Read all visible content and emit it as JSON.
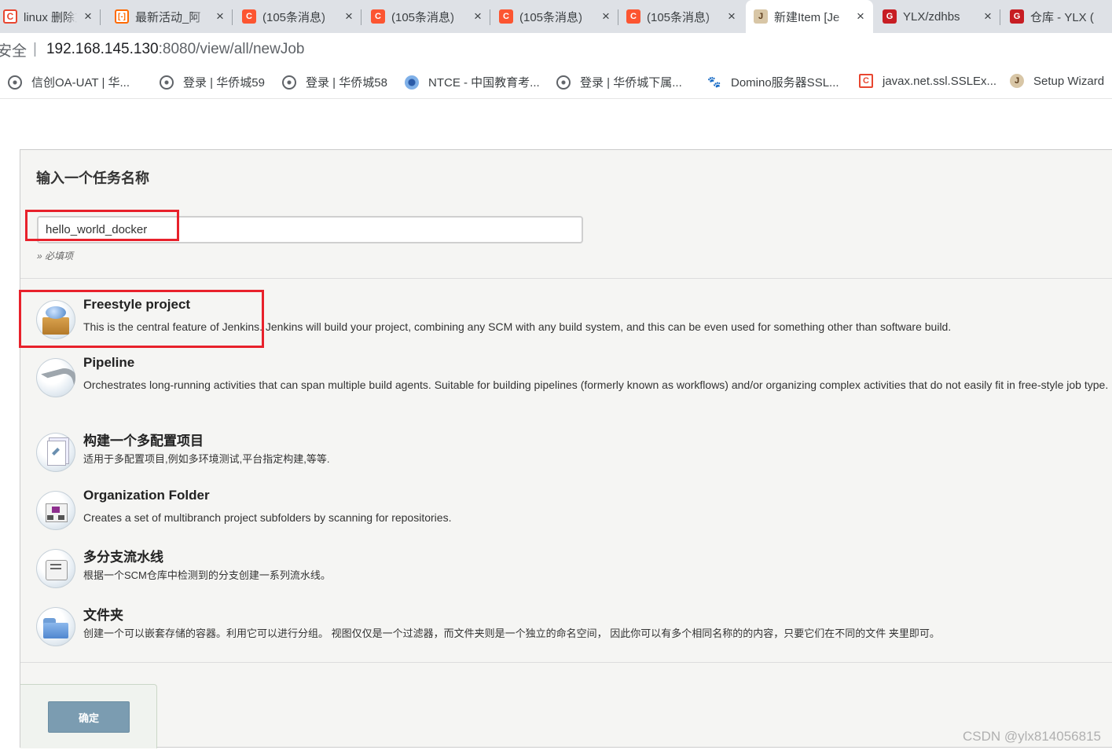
{
  "browser": {
    "tabs": [
      {
        "title": "linux 删除文",
        "favicon": "csdn-b",
        "glyph": "C"
      },
      {
        "title": "最新活动_阿",
        "favicon": "ali",
        "glyph": "[-]"
      },
      {
        "title": "(105条消息)",
        "favicon": "csdn",
        "glyph": "C"
      },
      {
        "title": "(105条消息)",
        "favicon": "csdn",
        "glyph": "C"
      },
      {
        "title": "(105条消息)",
        "favicon": "csdn",
        "glyph": "C"
      },
      {
        "title": "(105条消息)",
        "favicon": "csdn",
        "glyph": "C"
      },
      {
        "title": "新建Item [Je",
        "favicon": "jenkins",
        "glyph": "J"
      },
      {
        "title": "YLX/zdhbs",
        "favicon": "gitee",
        "glyph": "G"
      },
      {
        "title": "仓库 - YLX (",
        "favicon": "gitee",
        "glyph": "G"
      }
    ],
    "close_glyph": "×",
    "address": {
      "security": "安全",
      "separator": "|",
      "host": "192.168.145.130",
      "path": ":8080/view/all/newJob"
    },
    "bookmarks": [
      {
        "label": "信创OA-UAT | 华...",
        "icon": "globe-icon"
      },
      {
        "label": "登录 | 华侨城59",
        "icon": "globe-icon"
      },
      {
        "label": "登录 | 华侨城58",
        "icon": "globe-icon"
      },
      {
        "label": "NTCE - 中国教育考...",
        "icon": "ntce-icon"
      },
      {
        "label": "登录 | 华侨城下属...",
        "icon": "globe-icon"
      },
      {
        "label": "Domino服务器SSL...",
        "icon": "baidu-icon"
      },
      {
        "label": "javax.net.ssl.SSLEx...",
        "icon": "csdn-icon"
      },
      {
        "label": "Setup Wizard",
        "icon": "jenkins-icon"
      }
    ]
  },
  "form": {
    "heading": "输入一个任务名称",
    "job_name": "hello_world_docker",
    "required_hint": "» 必填项"
  },
  "item_types": [
    {
      "name": "Freestyle project",
      "description": "This is the central feature of Jenkins. Jenkins will build your project, combining any SCM with any build system, and this can be even used for something other than software build.",
      "icon": "freestyle-icon"
    },
    {
      "name": "Pipeline",
      "description": "Orchestrates long-running activities that can span multiple build agents. Suitable for building pipelines (formerly known as workflows) and/or organizing complex activities that do not easily fit in free-style job type.",
      "icon": "pipeline-icon"
    },
    {
      "name": "构建一个多配置项目",
      "description": "适用于多配置项目,例如多环境测试,平台指定构建,等等.",
      "icon": "multi-config-icon"
    },
    {
      "name": "Organization Folder",
      "description": "Creates a set of multibranch project subfolders by scanning for repositories.",
      "icon": "organization-folder-icon"
    },
    {
      "name": "多分支流水线",
      "description": "根据一个SCM仓库中检测到的分支创建一系列流水线。",
      "icon": "multibranch-icon"
    },
    {
      "name": "文件夹",
      "description": "创建一个可以嵌套存储的容器。利用它可以进行分组。 视图仅仅是一个过滤器，而文件夹则是一个独立的命名空间， 因此你可以有多个相同名称的的内容，只要它们在不同的文件 夹里即可。",
      "icon": "folder-icon"
    }
  ],
  "actions": {
    "ok_label": "确定"
  },
  "watermark": "CSDN @ylx814056815",
  "colors": {
    "highlight": "#e8212b",
    "ok_button": "#7b9cb1",
    "panel_bg": "#f5f5f3"
  }
}
